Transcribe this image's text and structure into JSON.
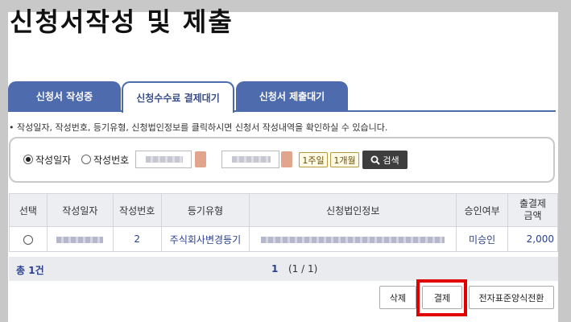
{
  "page": {
    "title": "신청서작성 및 제출"
  },
  "tabs": [
    {
      "label": "신청서 작성중",
      "active": false
    },
    {
      "label": "신청수수료 결제대기",
      "active": true
    },
    {
      "label": "신청서 제출대기",
      "active": false
    }
  ],
  "notice": "• 작성일자, 작성번호, 등기유형, 신청법인정보를 클릭하시면 신청서 작성내역을 확인하실 수 있습니다.",
  "search": {
    "radio_date_label": "작성일자",
    "radio_number_label": "작성번호",
    "selected": "작성일자",
    "period_1week": "1주일",
    "period_1month": "1개월",
    "search_button": "검색"
  },
  "table": {
    "headers": [
      "선택",
      "작성일자",
      "작성번호",
      "등기유형",
      "신청법인정보",
      "승인여부",
      "출결제\n금액"
    ],
    "rows": [
      {
        "date": "",
        "number": "2",
        "type": "주식회사변경등기",
        "corp_info": "",
        "approval": "미승인",
        "amount": "2,000"
      }
    ]
  },
  "footer": {
    "total_prefix": "총 ",
    "total_count": "1",
    "total_suffix": "건",
    "current_page": "1",
    "page_summary": "(1 / 1)"
  },
  "actions": {
    "delete": "삭제",
    "pay": "결제",
    "convert": "전자표준양식전환"
  },
  "colors": {
    "tab_blue": "#4e6bad",
    "highlight": "#e00000",
    "link_blue": "#2a3f8f"
  }
}
